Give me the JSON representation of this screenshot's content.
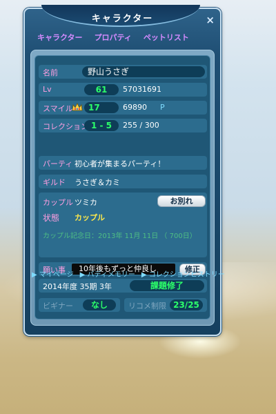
{
  "window": {
    "title": "キャラクター",
    "close_symbol": "×"
  },
  "tabs": [
    {
      "label": "キャラクター"
    },
    {
      "label": "プロパティ"
    },
    {
      "label": "ペットリスト"
    }
  ],
  "profile": {
    "name_label": "名前",
    "name": "野山うさぎ",
    "lv_label": "Lv",
    "lv": "61",
    "lv_value": "57031691",
    "smile_label": "スマイル",
    "smile_level": "17",
    "smile_value": "69890",
    "smile_unit": "P",
    "collection_label": "コレクション",
    "collection_range": "1 - 5",
    "collection_progress": "255 / 300"
  },
  "party": {
    "label": "パーティ",
    "value": "初心者が集まるパーティ！"
  },
  "guild": {
    "label": "ギルド",
    "value": "うさぎ＆カミ"
  },
  "couple": {
    "label": "カップル",
    "partner": "ツミカ",
    "breakup_button": "お別れ",
    "status_label": "状態",
    "status_value": "カップル",
    "anniversary": "カップル記念日：2013年 11月 11日 （ 700日）"
  },
  "wish": {
    "label": "願い事",
    "value": "10年後もずっと仲良し",
    "edit_button": "修正"
  },
  "season": {
    "term": "2014年度 35期 3年",
    "status": "課題修了"
  },
  "beginner": {
    "label": "ビギナー",
    "value": "なし",
    "limit_label": "リコメ制限",
    "limit_value": "23/25"
  },
  "nav_links": [
    {
      "label": "▶ マイページ"
    },
    {
      "label": "▶ バディメモリー"
    },
    {
      "label": "▶ コレクションヒストリー"
    }
  ],
  "colors": {
    "accent_green": "#2cff6a",
    "label_pink": "#ff9fe2",
    "tab_purple": "#d58bff",
    "highlight_yellow": "#ffe94a",
    "link_blue": "#7fdcff"
  }
}
